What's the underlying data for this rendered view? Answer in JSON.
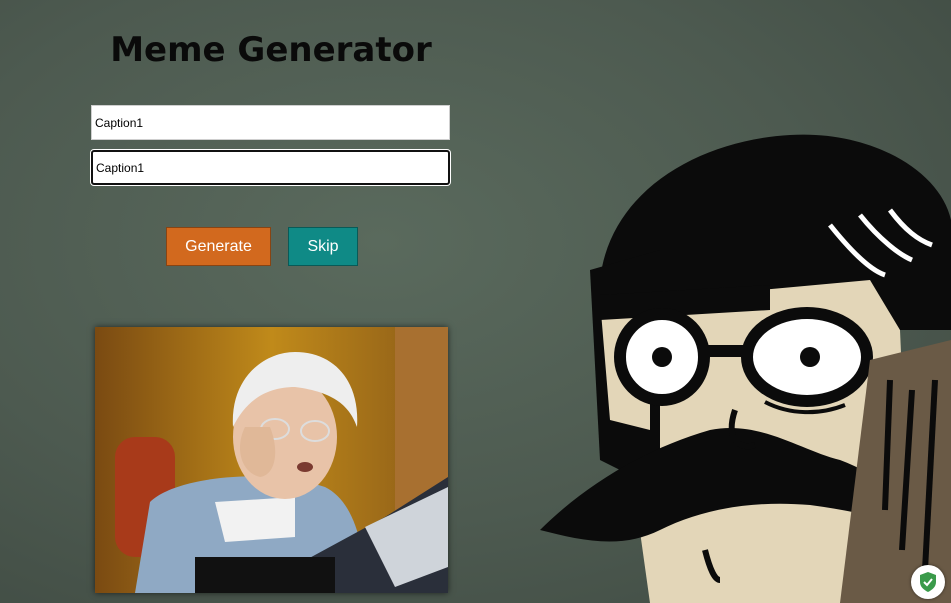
{
  "app": {
    "title": "Meme Generator"
  },
  "form": {
    "caption1_value": "Caption1",
    "caption2_value": "Caption1",
    "generate_label": "Generate",
    "skip_label": "Skip"
  },
  "colors": {
    "generate_button": "#d2691e",
    "skip_button": "#0f8a86",
    "background": "#4d5a50"
  },
  "meme": {
    "image": "old-lady-computer-meme"
  },
  "decor": {
    "background_character": "cartoon-man-mustache-glasses",
    "badge_icon": "shield-check-icon"
  }
}
